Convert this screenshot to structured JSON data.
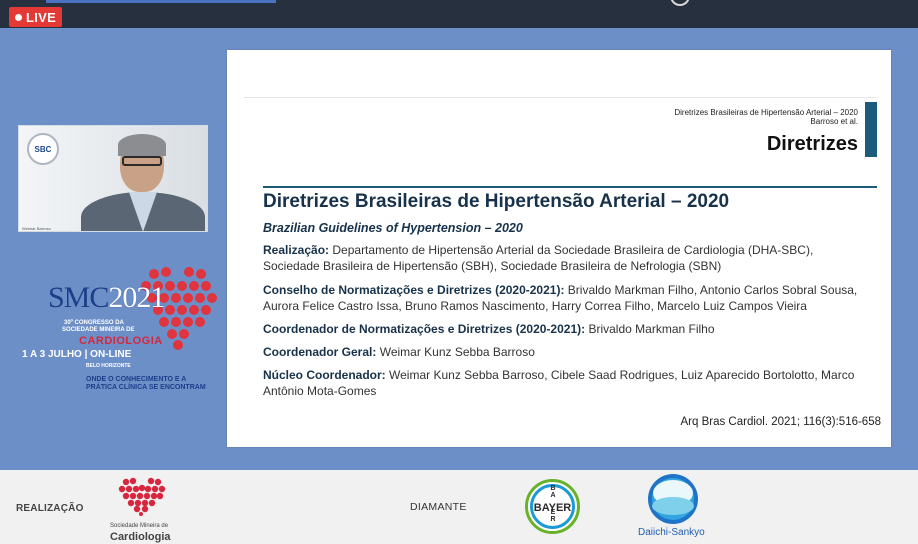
{
  "player": {
    "live_label": "LIVE"
  },
  "camera": {
    "logo_text": "SBC",
    "participant_name": "Weimar Barroso"
  },
  "congress": {
    "logo_smc": "SMC",
    "logo_year": "2021",
    "line1": "30º CONGRESSO DA",
    "line2": "SOCIEDADE MINEIRA DE",
    "line3": "CARDIOLOGIA",
    "dates": "1 A 3 JULHO | ON-LINE",
    "city": "BELO HORIZONTE",
    "tagline": "ONDE O CONHECIMENTO E A PRÁTICA CLÍNICA SE ENCONTRAM"
  },
  "slide": {
    "header_small_1": "Diretrizes Brasileiras de Hipertensão Arterial – 2020",
    "header_small_2": "Barroso et al.",
    "header_big": "Diretrizes",
    "title": "Diretrizes Brasileiras de Hipertensão Arterial – 2020",
    "subtitle": "Brazilian Guidelines of Hypertension – 2020",
    "paragraphs": [
      {
        "label": "Realização:",
        "text": "Departamento de Hipertensão Arterial da Sociedade Brasileira de Cardiologia (DHA-SBC), Sociedade Brasileira de Hipertensão (SBH), Sociedade Brasileira de Nefrologia (SBN)"
      },
      {
        "label": "Conselho de Normatizações e Diretrizes (2020-2021):",
        "text": "Brivaldo Markman Filho, Antonio Carlos Sobral Sousa, Aurora Felice Castro Issa, Bruno Ramos Nascimento, Harry Correa Filho, Marcelo Luiz Campos Vieira"
      },
      {
        "label": "Coordenador de Normatizações e Diretrizes (2020-2021):",
        "text": "Brivaldo Markman Filho"
      },
      {
        "label": "Coordenador Geral:",
        "text": "Weimar Kunz Sebba Barroso"
      },
      {
        "label": "Núcleo Coordenador:",
        "text": "Weimar Kunz Sebba Barroso, Cibele Saad Rodrigues, Luiz Aparecido Bortolotto, Marco Antônio Mota-Gomes"
      }
    ],
    "citation": "Arq Bras Cardiol. 2021; 116(3):516-658"
  },
  "footer": {
    "realizacao_label": "REALIZAÇÃO",
    "smmc_line1": "Sociedade Mineira de",
    "smmc_line2": "Cardiologia",
    "diamante_label": "DIAMANTE",
    "bayer_text": "BAYER",
    "bayer_vertical": [
      "B",
      "A",
      "Y",
      "E",
      "R"
    ],
    "daiichi_text": "Daiichi-Sankyo"
  },
  "colors": {
    "stage_bg": "#6d8fc7",
    "live_red": "#e53935",
    "slide_navy": "#17324a",
    "slide_accent": "#1d5b7a",
    "congress_red": "#d7263d",
    "congress_blue": "#1c3f8a"
  }
}
